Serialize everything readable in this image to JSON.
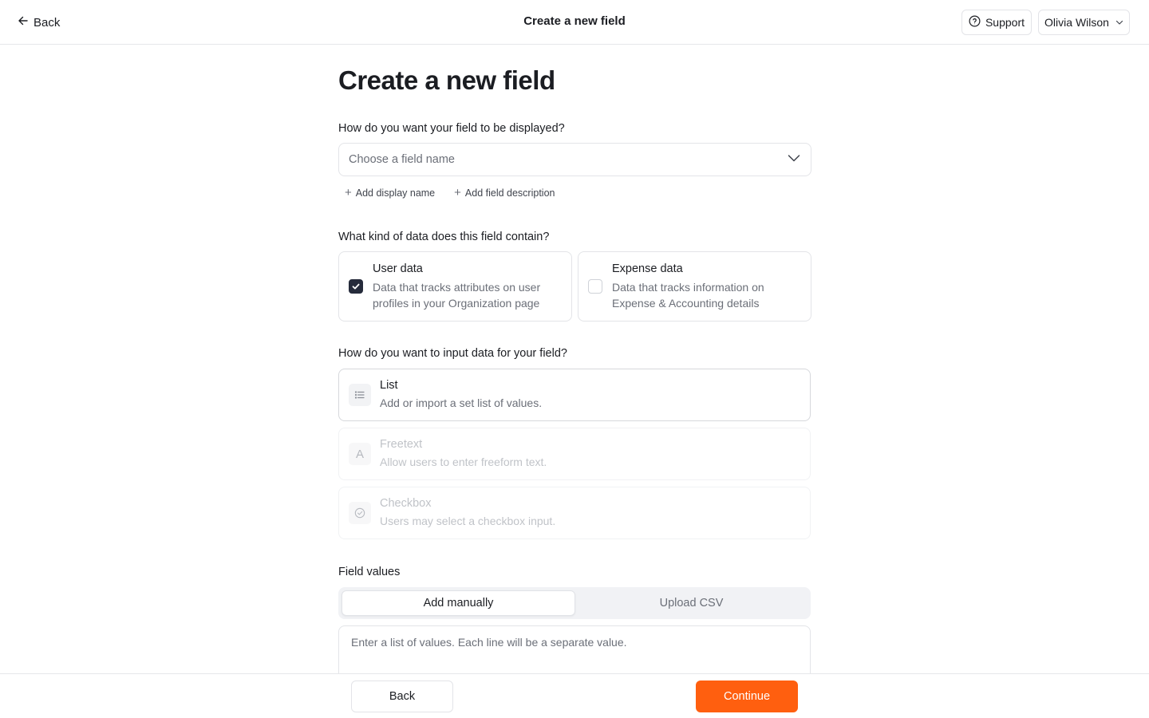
{
  "header": {
    "back_label": "Back",
    "title": "Create a new field",
    "support_label": "Support",
    "user_name": "Olivia Wilson"
  },
  "main": {
    "page_title": "Create a new field",
    "display_question": "How do you want your field to be displayed?",
    "field_name_select": {
      "placeholder": "Choose a field name"
    },
    "add_display_name": "Add display name",
    "add_field_description": "Add field description",
    "data_kind_question": "What kind of data does this field contain?",
    "data_kinds": [
      {
        "title": "User data",
        "description": "Data that tracks attributes on user profiles in your Organization page",
        "checked": true
      },
      {
        "title": "Expense data",
        "description": "Data that tracks information on Expense & Accounting details",
        "checked": false
      }
    ],
    "input_question": "How do you want to input data for your field?",
    "input_types": [
      {
        "title": "List",
        "description": "Add or import a set list of values.",
        "icon": "list-icon",
        "active": true
      },
      {
        "title": "Freetext",
        "description": "Allow users to enter freeform text.",
        "icon": "letter-a-icon",
        "glyph": "A",
        "active": false
      },
      {
        "title": "Checkbox",
        "description": "Users may select a checkbox input.",
        "icon": "check-circle-icon",
        "active": false
      }
    ],
    "field_values_label": "Field values",
    "value_tabs": [
      {
        "label": "Add manually",
        "active": true
      },
      {
        "label": "Upload CSV",
        "active": false
      }
    ],
    "values_textarea": {
      "placeholder": "Enter a list of values. Each line will be a separate value.",
      "value": ""
    }
  },
  "footer": {
    "back_label": "Back",
    "continue_label": "Continue"
  },
  "colors": {
    "accent": "#ff5f0f",
    "checkbox_checked": "#252b3b",
    "border": "#e3e4e8",
    "muted_text": "#6b6f78"
  }
}
